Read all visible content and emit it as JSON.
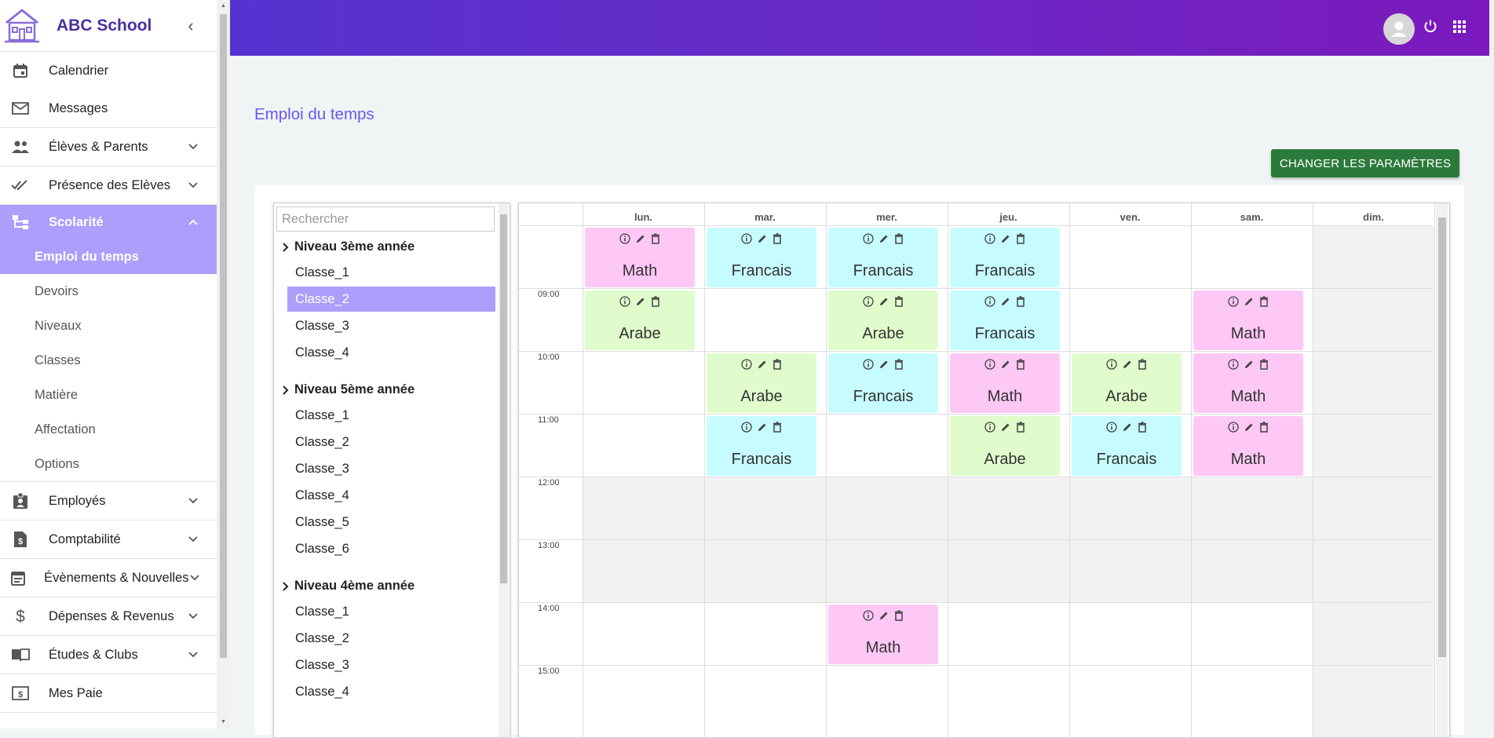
{
  "app": {
    "name": "ABC School"
  },
  "sidebar": {
    "items": [
      {
        "label": "Calendrier",
        "icon": "calendar-icon"
      },
      {
        "label": "Messages",
        "icon": "mail-icon"
      },
      {
        "label": "Élèves & Parents",
        "icon": "people-icon",
        "expandable": true
      },
      {
        "label": "Présence des Elèves",
        "icon": "double-check-icon",
        "expandable": true
      },
      {
        "label": "Scolarité",
        "icon": "hierarchy-icon",
        "expandable": true,
        "expanded": true,
        "active": true
      },
      {
        "label": "Employés",
        "icon": "badge-icon",
        "expandable": true
      },
      {
        "label": "Comptabilité",
        "icon": "invoice-icon",
        "expandable": true
      },
      {
        "label": "Évènements & Nouvelles",
        "icon": "event-icon",
        "expandable": true
      },
      {
        "label": "Dépenses & Revenus",
        "icon": "dollar-icon",
        "expandable": true
      },
      {
        "label": "Études & Clubs",
        "icon": "book-icon",
        "expandable": true
      },
      {
        "label": "Mes Paie",
        "icon": "payslip-icon"
      }
    ],
    "sub_items": [
      {
        "label": "Emploi du temps",
        "active": true
      },
      {
        "label": "Devoirs"
      },
      {
        "label": "Niveaux"
      },
      {
        "label": "Classes"
      },
      {
        "label": "Matière"
      },
      {
        "label": "Affectation"
      },
      {
        "label": "Options"
      }
    ]
  },
  "main": {
    "title": "Emploi du temps",
    "change_button": "CHANGER LES PARAMÈTRES"
  },
  "tree": {
    "search_placeholder": "Rechercher",
    "groups": [
      {
        "label": "Niveau 3ème année",
        "classes": [
          "Classe_1",
          "Classe_2",
          "Classe_3",
          "Classe_4"
        ],
        "selected": "Classe_2"
      },
      {
        "label": "Niveau 5ème année",
        "classes": [
          "Classe_1",
          "Classe_2",
          "Classe_3",
          "Classe_4",
          "Classe_5",
          "Classe_6"
        ]
      },
      {
        "label": "Niveau 4ème année",
        "classes": [
          "Classe_1",
          "Classe_2",
          "Classe_3",
          "Classe_4"
        ]
      }
    ]
  },
  "calendar": {
    "days": [
      "lun.",
      "mar.",
      "mer.",
      "jeu.",
      "ven.",
      "sam.",
      "dim."
    ],
    "times": [
      "09:00",
      "10:00",
      "11:00",
      "12:00",
      "13:00",
      "14:00",
      "15:00"
    ],
    "events": [
      {
        "day": 0,
        "slot": 0,
        "subject": "Math",
        "color": "pink"
      },
      {
        "day": 1,
        "slot": 0,
        "subject": "Francais",
        "color": "cyan"
      },
      {
        "day": 2,
        "slot": 0,
        "subject": "Francais",
        "color": "cyan"
      },
      {
        "day": 3,
        "slot": 0,
        "subject": "Francais",
        "color": "cyan"
      },
      {
        "day": 0,
        "slot": 1,
        "subject": "Arabe",
        "color": "green"
      },
      {
        "day": 2,
        "slot": 1,
        "subject": "Arabe",
        "color": "green"
      },
      {
        "day": 3,
        "slot": 1,
        "subject": "Francais",
        "color": "cyan"
      },
      {
        "day": 5,
        "slot": 1,
        "subject": "Math",
        "color": "pink"
      },
      {
        "day": 1,
        "slot": 2,
        "subject": "Arabe",
        "color": "green"
      },
      {
        "day": 2,
        "slot": 2,
        "subject": "Francais",
        "color": "cyan"
      },
      {
        "day": 3,
        "slot": 2,
        "subject": "Math",
        "color": "pink"
      },
      {
        "day": 4,
        "slot": 2,
        "subject": "Arabe",
        "color": "green"
      },
      {
        "day": 5,
        "slot": 2,
        "subject": "Math",
        "color": "pink"
      },
      {
        "day": 1,
        "slot": 3,
        "subject": "Francais",
        "color": "cyan"
      },
      {
        "day": 3,
        "slot": 3,
        "subject": "Arabe",
        "color": "green"
      },
      {
        "day": 4,
        "slot": 3,
        "subject": "Francais",
        "color": "cyan"
      },
      {
        "day": 5,
        "slot": 3,
        "subject": "Math",
        "color": "pink"
      },
      {
        "day": 2,
        "slot": 6,
        "subject": "Math",
        "color": "pink"
      }
    ],
    "colors": {
      "pink": "#fdc8f6",
      "cyan": "#c6fcff",
      "green": "#e0fccc",
      "accent": "#ab9ffb"
    }
  }
}
